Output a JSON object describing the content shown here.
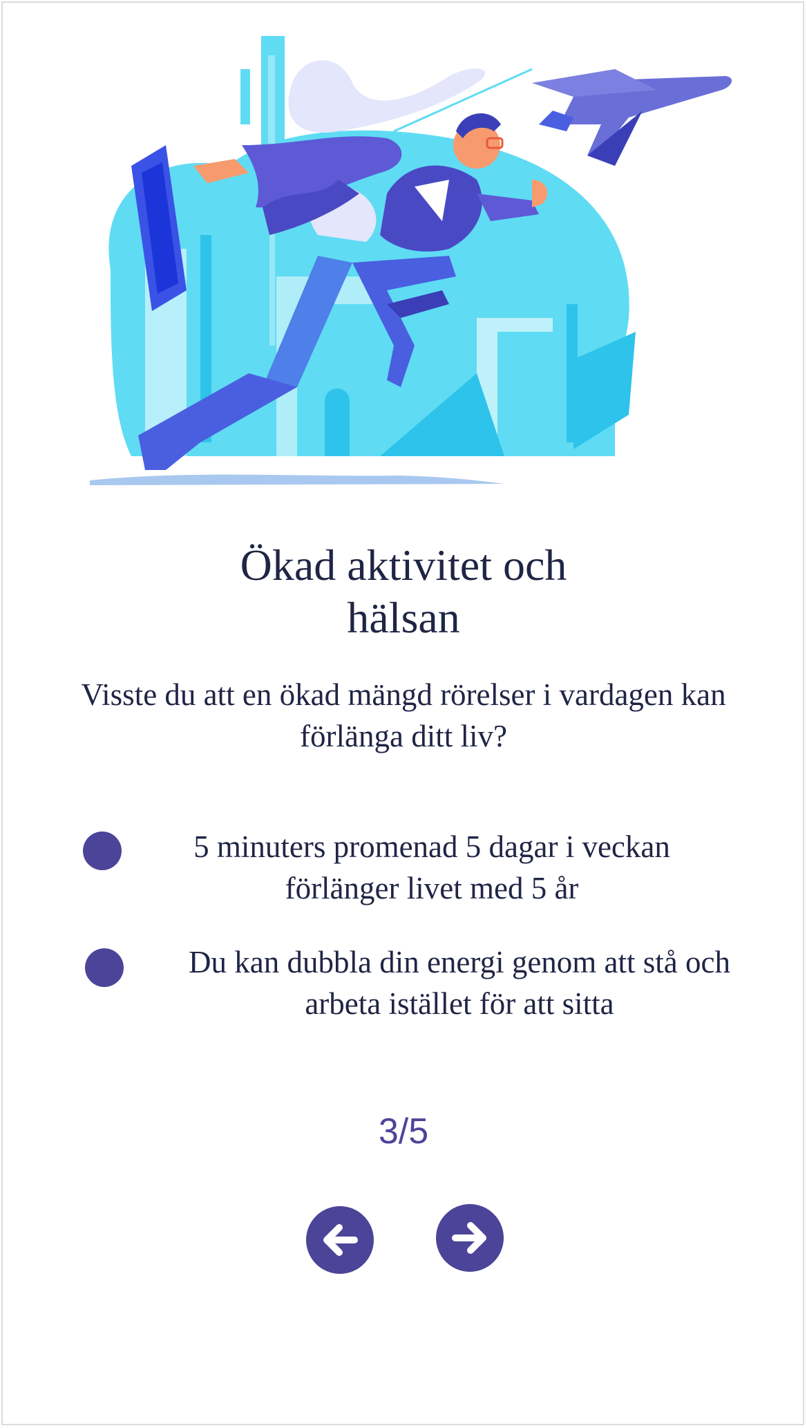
{
  "slide": {
    "title_line1": "Ökad aktivitet och",
    "title_line2": "hälsan",
    "intro": "Visste du att en ökad mängd rörelser i vardagen kan förlänga ditt liv?",
    "facts": [
      {
        "text": "5 minuters promenad 5 dagar i veckan förlänger livet med 5 år"
      },
      {
        "text": "Du kan dubbla din energi genom att stå och arbeta istället för att sitta"
      }
    ],
    "counter": "3/5"
  },
  "navigation": {
    "prev_icon": "arrow-left-icon",
    "next_icon": "arrow-right-icon"
  },
  "colors": {
    "accent": "#4b4499",
    "text": "#1f2545",
    "illustration_light_blue": "#5fdcf3",
    "illustration_blue": "#4a5fe0",
    "illustration_indigo": "#5e5ad6"
  },
  "illustration": {
    "icon": "businessman-flying-over-city-illustration"
  }
}
